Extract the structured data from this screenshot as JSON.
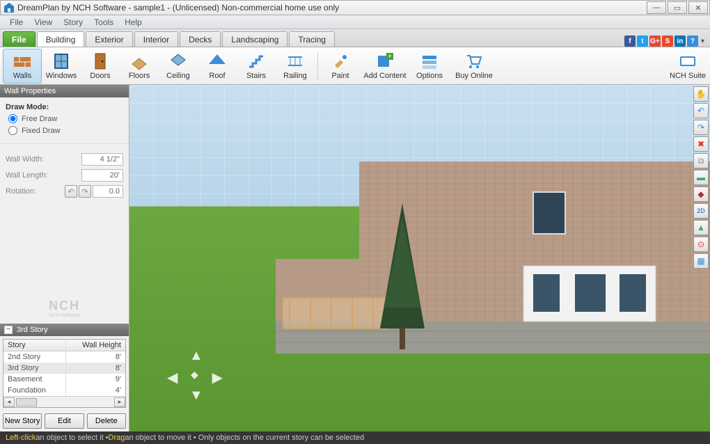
{
  "title": "DreamPlan by NCH Software - sample1 - (Unlicensed) Non-commercial home use only",
  "menu": [
    "File",
    "View",
    "Story",
    "Tools",
    "Help"
  ],
  "tabs": {
    "file": "File",
    "items": [
      "Building",
      "Exterior",
      "Interior",
      "Decks",
      "Landscaping",
      "Tracing"
    ],
    "active": "Building"
  },
  "toolbar": [
    {
      "label": "Walls",
      "icon": "walls",
      "active": true
    },
    {
      "label": "Windows",
      "icon": "windows"
    },
    {
      "label": "Doors",
      "icon": "doors"
    },
    {
      "label": "Floors",
      "icon": "floors"
    },
    {
      "label": "Ceiling",
      "icon": "ceiling"
    },
    {
      "label": "Roof",
      "icon": "roof"
    },
    {
      "label": "Stairs",
      "icon": "stairs"
    },
    {
      "label": "Railing",
      "icon": "railing"
    }
  ],
  "toolbar2": [
    {
      "label": "Paint",
      "icon": "paint"
    },
    {
      "label": "Add Content",
      "icon": "add",
      "wide": true
    },
    {
      "label": "Options",
      "icon": "options"
    },
    {
      "label": "Buy Online",
      "icon": "buy",
      "wide": true
    }
  ],
  "nch_suite": "NCH Suite",
  "panel": {
    "title": "Wall Properties",
    "draw_mode_label": "Draw Mode:",
    "free_draw": "Free Draw",
    "fixed_draw": "Fixed Draw",
    "wall_width_label": "Wall Width:",
    "wall_width": "4 1/2\"",
    "wall_length_label": "Wall Length:",
    "wall_length": "20'",
    "rotation_label": "Rotation:",
    "rotation": "0.0"
  },
  "logo": {
    "main": "NCH",
    "sub": "NCH Software"
  },
  "story_section": {
    "title": "3rd Story",
    "cols": [
      "Story",
      "Wall Height"
    ],
    "rows": [
      {
        "name": "2nd Story",
        "height": "8'"
      },
      {
        "name": "3rd Story",
        "height": "8'",
        "sel": true
      },
      {
        "name": "Basement",
        "height": "9'"
      },
      {
        "name": "Foundation",
        "height": "4'"
      }
    ],
    "buttons": [
      "New Story",
      "Edit",
      "Delete"
    ]
  },
  "right_tools": [
    {
      "name": "pan-icon",
      "glyph": "✋",
      "color": "#2a8"
    },
    {
      "name": "undo-icon",
      "glyph": "↶",
      "color": "#3a8ed8"
    },
    {
      "name": "redo-icon",
      "glyph": "↷",
      "color": "#3a8ed8"
    },
    {
      "name": "delete-icon",
      "glyph": "✖",
      "color": "#d33"
    },
    {
      "name": "copy-icon",
      "glyph": "⧉",
      "color": "#888"
    },
    {
      "name": "story-icon",
      "glyph": "▬",
      "color": "#3a7"
    },
    {
      "name": "terrain-icon",
      "glyph": "◆",
      "color": "#a33"
    },
    {
      "name": "2d-icon",
      "glyph": "2D",
      "color": "#3a8ed8"
    },
    {
      "name": "roof-icon",
      "glyph": "▲",
      "color": "#3a7"
    },
    {
      "name": "snap-icon",
      "glyph": "⊙",
      "color": "#d33"
    },
    {
      "name": "grid-icon",
      "glyph": "▦",
      "color": "#3a8ed8"
    }
  ],
  "status": {
    "left_click": "Left-click",
    "t1": " an object to select it • ",
    "drag": "Drag",
    "t2": " an object to move it • Only objects on the current story can be selected"
  },
  "social": [
    {
      "name": "facebook",
      "bg": "#3b5998",
      "g": "f"
    },
    {
      "name": "twitter",
      "bg": "#1da1f2",
      "g": "t"
    },
    {
      "name": "google",
      "bg": "#dd4b39",
      "g": "G+"
    },
    {
      "name": "stumble",
      "bg": "#eb4924",
      "g": "S"
    },
    {
      "name": "linkedin",
      "bg": "#0077b5",
      "g": "in"
    },
    {
      "name": "help",
      "bg": "#3a8ed8",
      "g": "?"
    }
  ]
}
